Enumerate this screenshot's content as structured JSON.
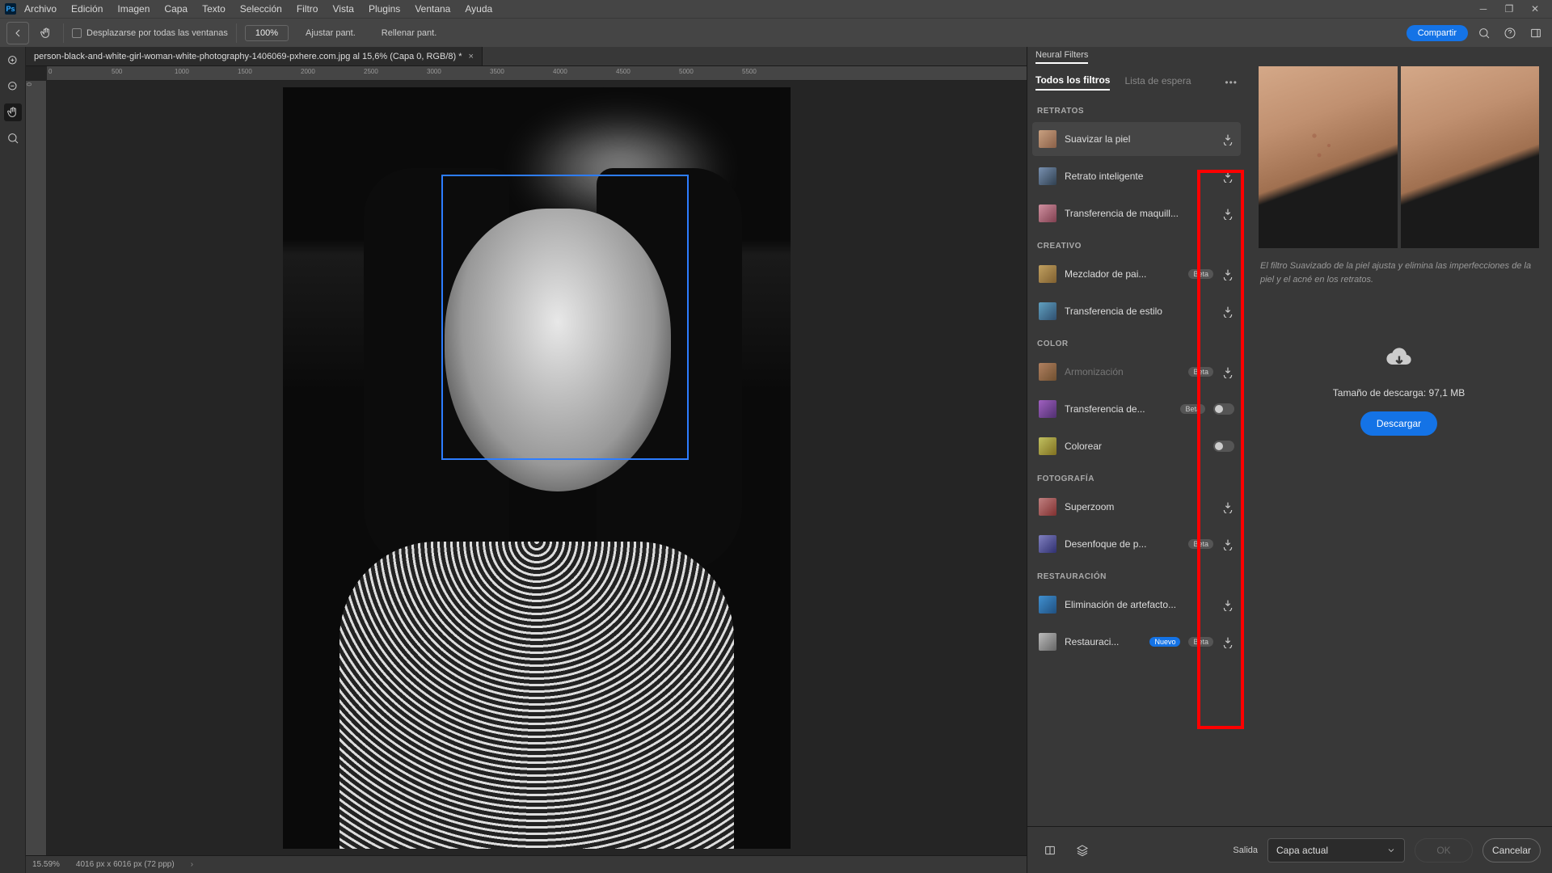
{
  "menubar": {
    "items": [
      "Archivo",
      "Edición",
      "Imagen",
      "Capa",
      "Texto",
      "Selección",
      "Filtro",
      "Vista",
      "Plugins",
      "Ventana",
      "Ayuda"
    ]
  },
  "optionbar": {
    "scroll_all": "Desplazarse por todas las ventanas",
    "zoom_100": "100%",
    "fit_screen": "Ajustar pant.",
    "fill_screen": "Rellenar pant.",
    "share": "Compartir"
  },
  "tab": {
    "title": "person-black-and-white-girl-woman-white-photography-1406069-pxhere.com.jpg al 15,6% (Capa 0, RGB/8) *"
  },
  "ruler_h": [
    "0",
    "500",
    "1000",
    "1500",
    "2000",
    "2500",
    "3000",
    "3500",
    "4000",
    "4500",
    "5000",
    "5500"
  ],
  "ruler_v": [
    "0"
  ],
  "statusbar": {
    "zoom": "15.59%",
    "dims": "4016 px x 6016 px (72 ppp)"
  },
  "panel": {
    "title": "Neural Filters",
    "tabs": {
      "all": "Todos los filtros",
      "waitlist": "Lista de espera"
    },
    "categories": {
      "retratos": "RETRATOS",
      "creativo": "CREATIVO",
      "color": "COLOR",
      "fotografia": "FOTOGRAFÍA",
      "restauracion": "RESTAURACIÓN"
    },
    "filters": {
      "suavizar": "Suavizar la piel",
      "retrato_int": "Retrato inteligente",
      "maquillaje": "Transferencia de maquill...",
      "mezclador": "Mezclador de pai...",
      "estilo": "Transferencia de estilo",
      "armonizacion": "Armonización",
      "trans_color": "Transferencia de...",
      "colorear": "Colorear",
      "superzoom": "Superzoom",
      "desenfoque": "Desenfoque de p...",
      "artefactos": "Eliminación de artefacto...",
      "restauracion": "Restauraci..."
    },
    "badges": {
      "beta": "Beta",
      "nuevo": "Nuevo"
    }
  },
  "detail": {
    "description": "El filtro Suavizado de la piel ajusta y elimina las imperfecciones de la piel y el acné en los retratos.",
    "size_label": "Tamaño de descarga: 97,1 MB",
    "download_btn": "Descargar"
  },
  "footer": {
    "output_label": "Salida",
    "output_value": "Capa actual",
    "ok": "OK",
    "cancel": "Cancelar"
  }
}
